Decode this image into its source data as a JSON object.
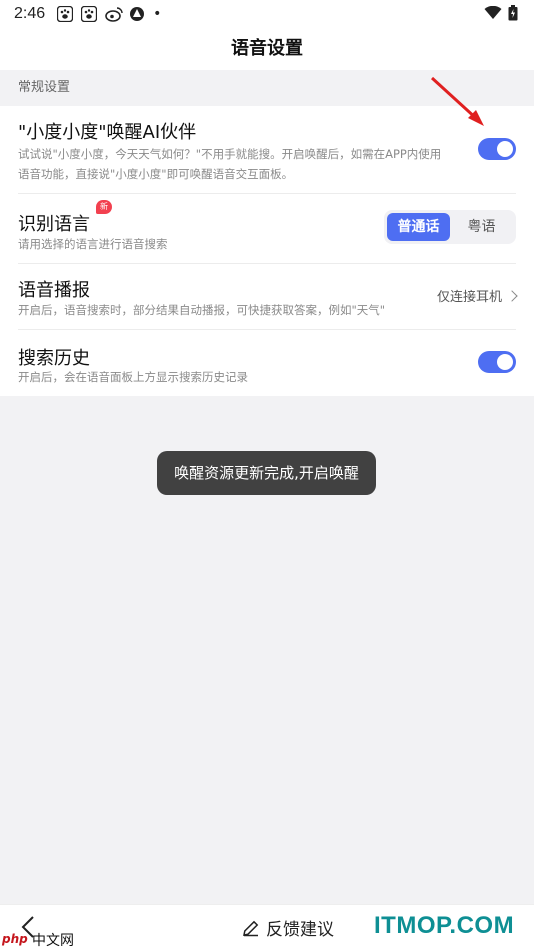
{
  "status_bar": {
    "time": "2:46",
    "icons": [
      "baidu-paw-icon",
      "baidu-paw-icon",
      "weibo-icon",
      "app-icon",
      "dot-icon"
    ],
    "right_icons": [
      "wifi-icon",
      "battery-icon"
    ]
  },
  "header": {
    "title": "语音设置"
  },
  "section": {
    "label": "常规设置"
  },
  "settings": {
    "wake": {
      "title": "\"小度小度\"唤醒AI伙伴",
      "desc_line1": "试试说\"小度小度，今天天气如何？\"不用手就能搜。开启唤醒后，如需在APP内使用",
      "desc_line2": "语音功能，直接说\"小度小度\"即可唤醒语音交互面板。",
      "enabled": true
    },
    "language": {
      "title": "识别语言",
      "badge": "新",
      "desc": "请用选择的语言进行语音搜索",
      "options": [
        "普通话",
        "粤语"
      ],
      "selected": "普通话"
    },
    "broadcast": {
      "title": "语音播报",
      "desc": "开启后，语音搜索时，部分结果自动播报，可快捷获取答案，例如\"天气\"",
      "value": "仅连接耳机"
    },
    "history": {
      "title": "搜索历史",
      "desc": "开启后，会在语音面板上方显示搜索历史记录",
      "enabled": true
    }
  },
  "toast": {
    "text": "唤醒资源更新完成,开启唤醒"
  },
  "bottom": {
    "feedback_label": "反馈建议"
  },
  "watermarks": {
    "php_mark": "php",
    "php_text": "中文网",
    "site": "ITMOP.COM"
  },
  "colors": {
    "accent": "#4e6ef2",
    "badge": "#f2404f",
    "watermark": "#0e8f94",
    "annotation": "#e02020"
  }
}
